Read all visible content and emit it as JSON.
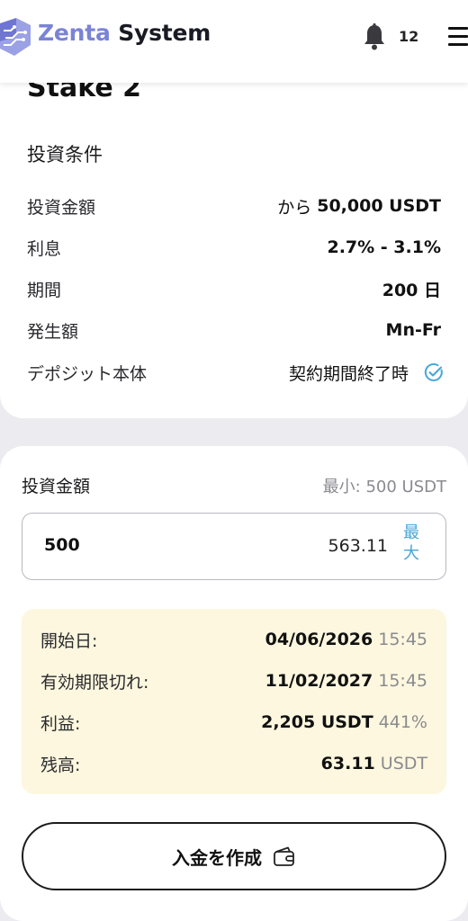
{
  "header": {
    "brand_part1": "Zenta",
    "brand_part2": "System",
    "notification_count": "12"
  },
  "plan": {
    "title": "Stake 2",
    "conditions_title": "投資条件",
    "rows": [
      {
        "label": "投資金額",
        "prefix": "から",
        "value": "50,000 USDT"
      },
      {
        "label": "利息",
        "value": "2.7% - 3.1%"
      },
      {
        "label": "期間",
        "value": "200 日"
      },
      {
        "label": "発生額",
        "value": "Mn-Fr"
      },
      {
        "label": "デポジット本体",
        "value": "契約期間終了時"
      }
    ]
  },
  "investment": {
    "label": "投資金額",
    "min_label": "最小: 500 USDT",
    "input_value": "500",
    "balance": "563.11",
    "max_label": "最大"
  },
  "summary": {
    "rows": [
      {
        "label": "開始日:",
        "value": "04/06/2026",
        "sub": "15:45"
      },
      {
        "label": "有効期限切れ:",
        "value": "11/02/2027",
        "sub": "15:45"
      },
      {
        "label": "利益:",
        "value": "2,205 USDT",
        "sub": "441%"
      },
      {
        "label": "残高:",
        "value": "63.11",
        "sub": "USDT"
      }
    ]
  },
  "action": {
    "deposit_label": "入金を作成"
  },
  "colors": {
    "accent_blue": "#46a6d6",
    "brand_purple": "#7b83d6",
    "summary_bg": "#fcf7de"
  }
}
